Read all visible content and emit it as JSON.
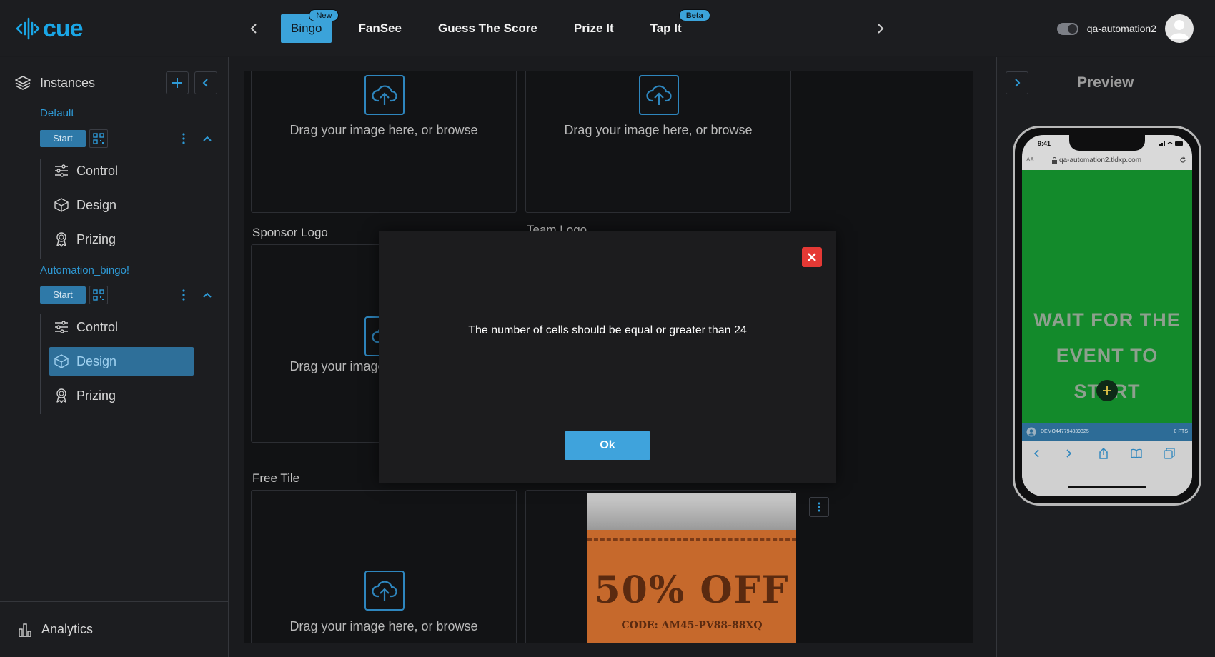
{
  "topbar": {
    "logo_text": "cue",
    "tabs": [
      {
        "label": "Bingo",
        "badge": "New",
        "active": true
      },
      {
        "label": "FanSee",
        "badge": "",
        "active": false
      },
      {
        "label": "Guess The Score",
        "badge": "",
        "active": false
      },
      {
        "label": "Prize It",
        "badge": "",
        "active": false
      },
      {
        "label": "Tap It",
        "badge": "Beta",
        "active": false
      }
    ],
    "username": "qa-automation2"
  },
  "sidebar": {
    "title": "Instances",
    "instances": [
      {
        "name": "Default",
        "start_label": "Start",
        "items": [
          "Control",
          "Design",
          "Prizing"
        ]
      },
      {
        "name": "Automation_bingo!",
        "start_label": "Start",
        "items": [
          "Control",
          "Design",
          "Prizing"
        ],
        "active_item": "Design"
      }
    ],
    "analytics_label": "Analytics"
  },
  "main": {
    "upload_text": "Drag your image here, or browse",
    "sponsor_logo_label": "Sponsor Logo",
    "team_logo_label": "Team Logo",
    "free_tile_label": "Free Tile",
    "coupon": {
      "headline": "50% OFF",
      "code": "CODE: AM45-PV88-88XQ"
    }
  },
  "modal": {
    "message": "The number of cells should be equal or greater than 24",
    "ok_label": "Ok"
  },
  "preview": {
    "title": "Preview",
    "status_time": "9:41",
    "url_aa": "AA",
    "url": "qa-automation2.tldxp.com",
    "wait_line1": "WAIT FOR THE",
    "wait_line2": "EVENT TO START",
    "user_id": "DEMO447794839325",
    "points": "0 PTS"
  },
  "colors": {
    "accent": "#3ba3da",
    "close_red": "#e53935",
    "preview_green": "#138a2b"
  }
}
